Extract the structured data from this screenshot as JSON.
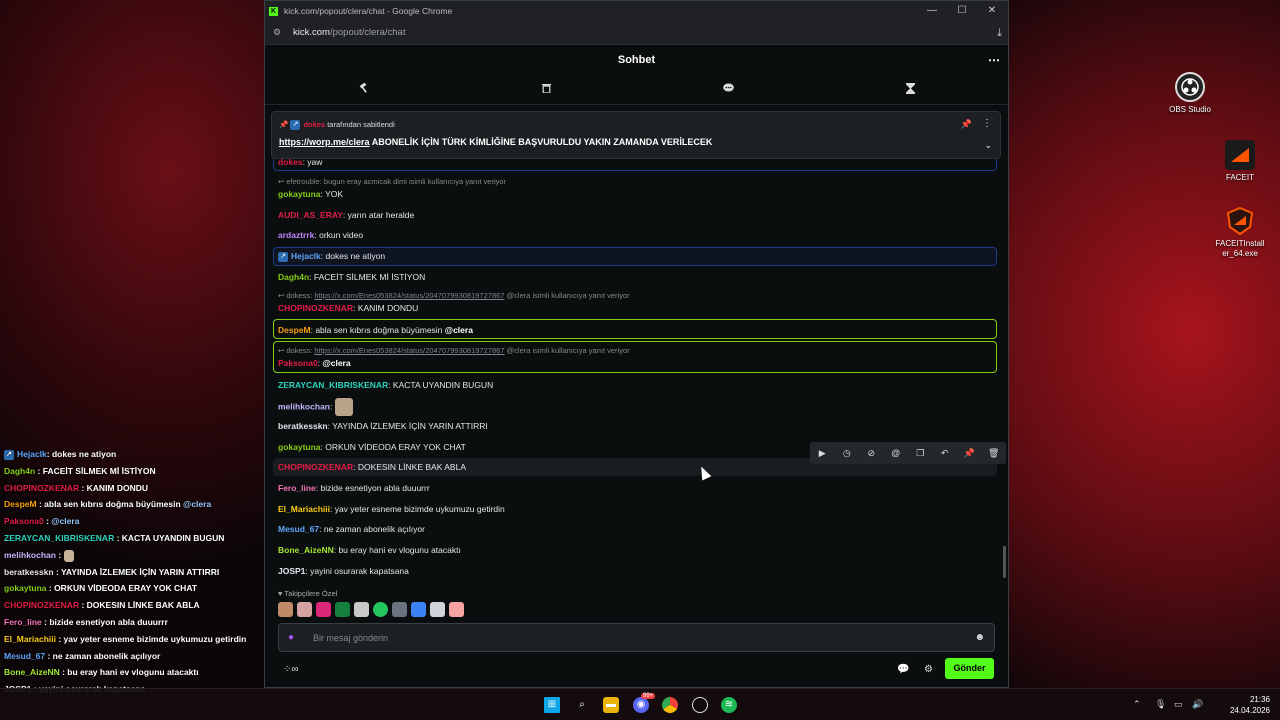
{
  "desktop": {
    "icons": [
      {
        "label": "OBS Studio",
        "icon": "obs-icon"
      },
      {
        "label": "FACEIT",
        "icon": "faceit-icon"
      },
      {
        "label": "FACEITInstall er_64.exe",
        "icon": "faceit-installer-icon"
      }
    ]
  },
  "overlay": {
    "lines": [
      {
        "user": "Hejaclk",
        "text": ": dokes ne atiyon",
        "color": "#60a5fa",
        "badge": true
      },
      {
        "user": "Dagh4n",
        "text": " : FACEİT SİLMEK Mİ İSTİYON",
        "color": "#84cc16"
      },
      {
        "user": "CHOPINOZKENAR",
        "text": " : KANIM DONDU",
        "color": "#e11d48"
      },
      {
        "user": "DespeM",
        "text": " : abla sen kıbrıs doğma büyümesin ",
        "mention": "@clera",
        "color": "#f59e0b"
      },
      {
        "user": "Paksona0",
        "text": " : ",
        "mention": "@clera",
        "color": "#e11d48"
      },
      {
        "user": "ZERAYCAN_KIBRISKENAR",
        "text": " : KACTA UYANDIN BUGUN",
        "color": "#2dd4bf"
      },
      {
        "user": "melihkochan",
        "text": " : ",
        "emote": true,
        "color": "#c4b5fd"
      },
      {
        "user": "beratkesskn",
        "text": " : YAYINDA İZLEMEK İÇİN YARIN ATTIRRI",
        "color": "#e5e7eb"
      },
      {
        "user": "gokaytuna",
        "text": " : ORKUN VİDEODA ERAY YOK CHAT",
        "color": "#84cc16"
      },
      {
        "user": "CHOPINOZKENAR",
        "text": " : DOKESIN LİNKE BAK ABLA",
        "color": "#e11d48"
      },
      {
        "user": "Fero_line",
        "text": " : bizide esnetiyon abla duuurrr",
        "color": "#f472b6"
      },
      {
        "user": "El_Mariachiii",
        "text": " : yav yeter esneme bizimde uykumuzu getirdin",
        "color": "#facc15"
      },
      {
        "user": "Mesud_67",
        "text": " : ne zaman abonelik açılıyor",
        "color": "#60a5fa"
      },
      {
        "user": "Bone_AizeNN",
        "text": " : bu eray hani ev vlogunu atacaktı",
        "color": "#a3e635"
      },
      {
        "user": "JOSP1",
        "text": " : yayini osurarak kapatsana",
        "color": "#e5e7eb"
      }
    ]
  },
  "window": {
    "title": "kick.com/popout/clera/chat - Google Chrome",
    "url_host": "kick.com",
    "url_path": "/popout/clera/chat",
    "controls": [
      "—",
      "☐",
      "✕"
    ]
  },
  "chat": {
    "header": "Sohbet",
    "pinned": {
      "pinned_by_user": "dokes",
      "pinned_by_text": " tarafından sabitlendi",
      "link": "https://worp.me/clera",
      "message": "  ABONELİK İÇİN TÜRK KİMLİĞİNE BAŞVURULDU YAKIN ZAMANDA VERİLECEK"
    },
    "messages": [
      {
        "user": "dokes",
        "text": ": yaw",
        "color": "#e11d48"
      },
      {
        "user": "gokaytuna",
        "text": ": YOK",
        "color": "#84cc16"
      },
      {
        "user": "AUDI_AS_ERAY",
        "text": ": yarın atar heralde",
        "color": "#e11d48"
      },
      {
        "user": "ardaztrrk",
        "text": ": orkun video",
        "color": "#c084fc"
      },
      {
        "user": "Hejaclk",
        "text": ": dokes ne atiyon",
        "color": "#60a5fa"
      },
      {
        "user": "Dagh4n",
        "text": ": FACEİT SİLMEK Mİ İSTİYON",
        "color": "#84cc16"
      },
      {
        "user": "CHOPINOZKENAR",
        "text": ": KANIM DONDU",
        "color": "#e11d48"
      },
      {
        "user": "DespeM",
        "text": ": abla sen kıbrıs doğma büyümesin ",
        "mention": "@clera",
        "color": "#f59e0b"
      },
      {
        "user": "Paksona0",
        "text": ": ",
        "mention": "@clera",
        "color": "#e11d48"
      },
      {
        "user": "ZERAYCAN_KIBRISKENAR",
        "text": ": KACTA UYANDIN BUGUN",
        "color": "#2dd4bf"
      },
      {
        "user": "melihkochan",
        "text": ": ",
        "color": "#c4b5fd"
      },
      {
        "user": "beratkesskn",
        "text": ": YAYINDA İZLEMEK İÇİN YARIN ATTIRRI",
        "color": "#e5e7eb"
      },
      {
        "user": "gokaytuna",
        "text": ": ORKUN VİDEODA ERAY YOK CHAT",
        "color": "#84cc16"
      },
      {
        "user": "CHOPINOZKENAR",
        "text": ": DOKESIN LİNKE BAK ABLA",
        "color": "#e11d48"
      },
      {
        "user": "Fero_line",
        "text": ": bizide esnetiyon abla duuurrr",
        "color": "#f472b6"
      },
      {
        "user": "El_Mariachiii",
        "text": ": yav yeter esneme bizimde uykumuzu getirdin",
        "color": "#facc15"
      },
      {
        "user": "Mesud_67",
        "text": ": ne zaman abonelik açılıyor",
        "color": "#60a5fa"
      },
      {
        "user": "Bone_AizeNN",
        "text": ": bu eray hani ev vlogunu atacaktı",
        "color": "#a3e635"
      },
      {
        "user": "JOSP1",
        "text": ": yayini osurarak kapatsana",
        "color": "#e5e7eb"
      }
    ],
    "replies": [
      {
        "text": "efetrouble: bugun eray acmicak dimi isimli kullanıcıya yanıt veriyor"
      },
      {
        "prefix": "dokess: ",
        "link": "https://x.com/Enes053824/status/2047079930819727867",
        "suffix": " @clera isimli kullanıcıya yanıt veriyor"
      },
      {
        "prefix": "dokess: ",
        "link": "https://x.com/Enes053824/status/2047079930819727867",
        "suffix": " @clera isimli kullanıcıya yanıt veriyor"
      }
    ],
    "followers_label": "Takipçilere Özel",
    "input_placeholder": "Bir mesaj gönderin",
    "send_label": "Gönder"
  },
  "taskbar": {
    "time": "21:36",
    "date": "24.04.2026",
    "discord_badge": "99+"
  }
}
